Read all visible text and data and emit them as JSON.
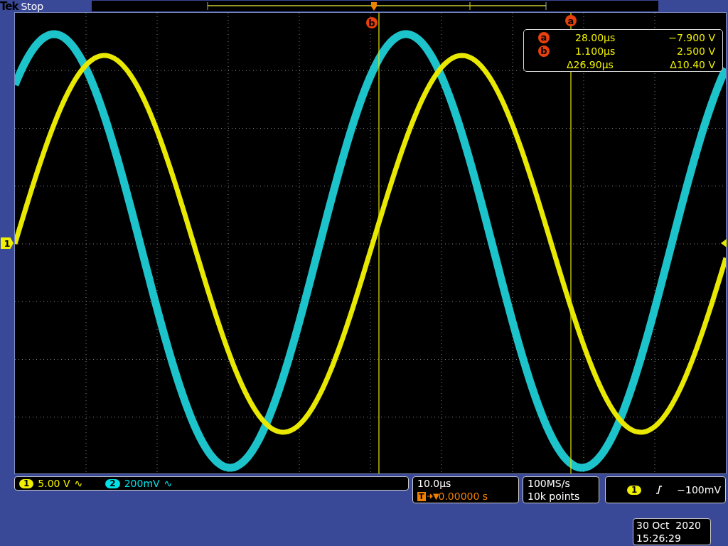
{
  "brand": "Tek",
  "run_state": "Stop",
  "cursor_markers": [
    {
      "label": "b"
    },
    {
      "label": "a"
    }
  ],
  "cursor_readout": {
    "rows": [
      {
        "label": "a",
        "time": "28.00µs",
        "value": "−7.900 V"
      },
      {
        "label": "b",
        "time": "1.100µs",
        "value": "2.500 V"
      }
    ],
    "delta_time": "Δ26.90µs",
    "delta_value": "Δ10.40 V"
  },
  "ground_marker": {
    "label": "1"
  },
  "channels": [
    {
      "number": "1",
      "scale": "5.00 V",
      "coupling": "∿",
      "color": "#f0f000"
    },
    {
      "number": "2",
      "scale": "200mV",
      "coupling": "∿",
      "color": "#00e0e8"
    }
  ],
  "timebase": {
    "scale": "10.0µs",
    "trigger_symbol": "T",
    "trigger_position": "0.00000 s"
  },
  "acquisition": {
    "sample_rate": "100MS/s",
    "record_length": "10k points"
  },
  "trigger": {
    "source": "1",
    "level": "−100mV"
  },
  "date": "30 Oct  2020",
  "time": "15:26:29"
}
